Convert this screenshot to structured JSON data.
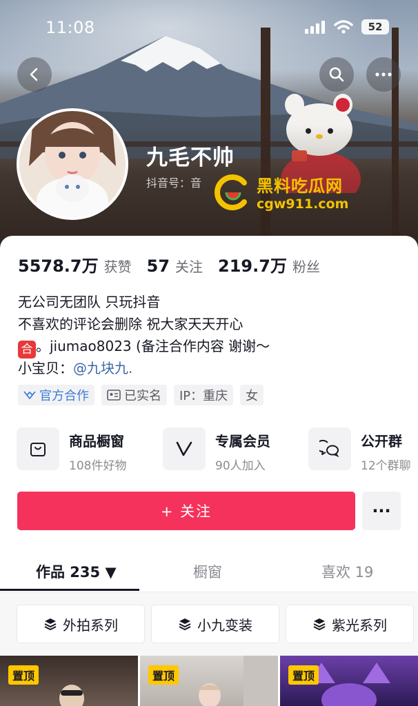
{
  "status_bar": {
    "time": "11:08",
    "battery": "52"
  },
  "header": {
    "name": "九毛不帅",
    "douyin_id": "抖音号：音",
    "watermark_cn": "黑料吃瓜网",
    "watermark_url": "cgw911.com"
  },
  "stats": [
    {
      "value": "5578.7万",
      "label": "获赞"
    },
    {
      "value": "57",
      "label": "关注"
    },
    {
      "value": "219.7万",
      "label": "粉丝"
    }
  ],
  "bio": {
    "line1": "无公司无团队 只玩抖音",
    "line2": "不喜欢的评论会删除 祝大家天天开心",
    "badge": "合",
    "line3": "。jiumao8023 (备注合作内容 谢谢～",
    "line4_prefix": "小宝贝：",
    "line4_mention": "@九块九."
  },
  "tags": {
    "official": "官方合作",
    "verified": "已实名",
    "ip": "IP：重庆",
    "gender": "女"
  },
  "features": [
    {
      "title": "商品橱窗",
      "sub": "108件好物",
      "icon": "shopping-bag-icon"
    },
    {
      "title": "专属会员",
      "sub": "90人加入",
      "icon": "v-member-icon"
    },
    {
      "title": "公开群",
      "sub": "12个群聊",
      "icon": "group-chat-icon"
    }
  ],
  "actions": {
    "follow": "+ 关注",
    "more": "···"
  },
  "tabs": [
    {
      "label": "作品 235 ▼"
    },
    {
      "label": "橱窗"
    },
    {
      "label": "喜欢 19"
    }
  ],
  "series": [
    {
      "label": "外拍系列"
    },
    {
      "label": "小九变装"
    },
    {
      "label": "紫光系列"
    }
  ],
  "thumbnails": [
    {
      "pin": "置顶"
    },
    {
      "pin": "置顶"
    },
    {
      "pin": "置顶"
    }
  ],
  "colors": {
    "follow": "#f5325c",
    "mention": "#3d67a8",
    "official": "#3b7bd8",
    "pin": "#ffc700",
    "watermark": "#f3c300"
  }
}
